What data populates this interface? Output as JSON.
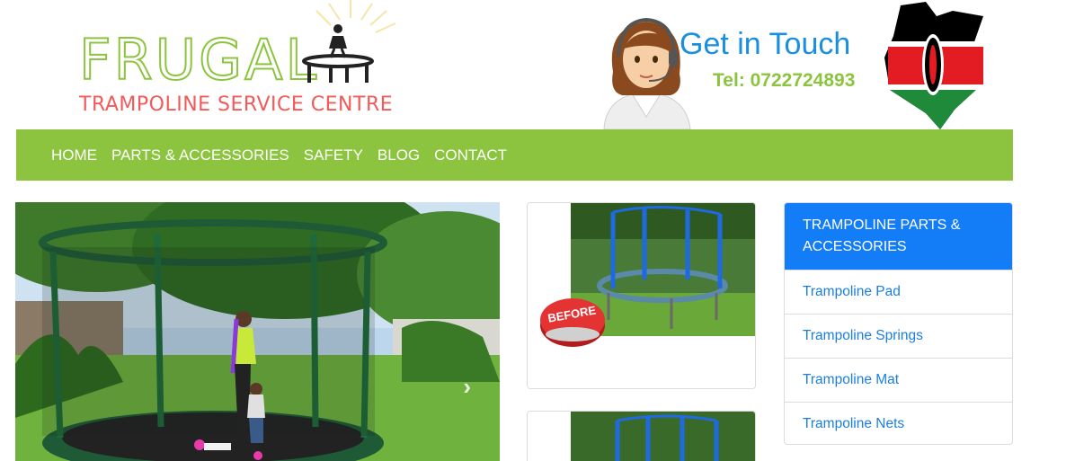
{
  "logo": {
    "word": "FRUGAL",
    "subtitle": "TRAMPOLINE SERVICE CENTRE"
  },
  "contact": {
    "title": "Get in Touch",
    "tel": "Tel: 0722724893"
  },
  "nav": {
    "items": [
      "HOME",
      "PARTS & ACCESSORIES",
      "SAFETY",
      "BLOG",
      "CONTACT"
    ]
  },
  "slider": {
    "next_icon": "chevron-right-icon",
    "next_glyph": "›"
  },
  "before_card": {
    "badge": "BEFORE"
  },
  "sidebar": {
    "heading": "TRAMPOLINE PARTS & ACCESSORIES",
    "items": [
      "Trampoline Pad",
      "Trampoline Springs",
      "Trampoline Mat",
      "Trampoline Nets"
    ]
  },
  "colors": {
    "brand_green": "#8cc43f",
    "link_blue": "#1a7fe0",
    "header_blue": "#137cf7",
    "logo_red": "#f25a5a"
  }
}
